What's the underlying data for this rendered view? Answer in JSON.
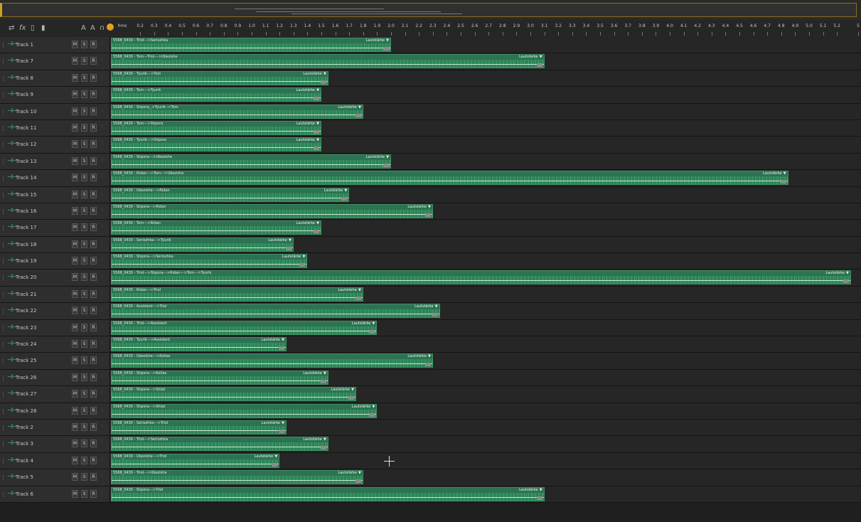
{
  "toolbar": {
    "swap_icon": "⇄",
    "fx_icon": "fx",
    "routing_icon": "▯",
    "meter_icon": "▮",
    "mute_icon": "A",
    "solo_icon": "A",
    "monitor_icon": "∩",
    "ruler_unit": "hms"
  },
  "ruler_labels": [
    "0.2",
    "0.3",
    "0.4",
    "0.5",
    "0.6",
    "0.7",
    "0.8",
    "0.9",
    "1.0",
    "1.1",
    "1.2",
    "1.3",
    "1.4",
    "1.5",
    "1.6",
    "1.7",
    "1.8",
    "1.9",
    "2.0",
    "2.1",
    "2.2",
    "2.3",
    "2.4",
    "2.5",
    "2.6",
    "2.7",
    "2.8",
    "2.9",
    "3.0",
    "3.1",
    "3.2",
    "3.3",
    "3.4",
    "3.5",
    "3.6",
    "3.7",
    "3.8",
    "3.9",
    "4.0",
    "4.1",
    "4.2",
    "4.3",
    "4.4",
    "4.5",
    "4.6",
    "4.7",
    "4.8",
    "4.9",
    "5.0",
    "5.1",
    "5.2",
    "5"
  ],
  "buttons": {
    "m": "M",
    "s": "S",
    "r": "R",
    "dots": "⋮"
  },
  "volume_label": "Lautstärke",
  "volume_arrow": "▼",
  "tracks": [
    {
      "name": "Track 1",
      "clip": "5568_0430 - Triol--->Seriozhka",
      "end_seconds": 2.0
    },
    {
      "name": "Track 7",
      "clip": "5568_0430 - Tom---Triol--->Ubezishe",
      "end_seconds": 3.1
    },
    {
      "name": "Track 8",
      "clip": "5568_0430 - Tyurik--->Tom",
      "end_seconds": 1.55
    },
    {
      "name": "Track 9",
      "clip": "5568_0430 - Tom--->Tyurik",
      "end_seconds": 1.5
    },
    {
      "name": "Track 10",
      "clip": "5568_0430 - Shpora_,>Tyurik-->Tom",
      "end_seconds": 1.8
    },
    {
      "name": "Track 11",
      "clip": "5568_0430 - Tom--->Shpora",
      "end_seconds": 1.5
    },
    {
      "name": "Track 12",
      "clip": "5568_0430 - Tyurik--->Shpora",
      "end_seconds": 1.5
    },
    {
      "name": "Track 13",
      "clip": "5568_0430 - Shpora--->Ubezishe",
      "end_seconds": 2.0
    },
    {
      "name": "Track 14",
      "clip": "5568_0430 - Ridan--->Tom--->Ubezishe",
      "end_seconds": 4.85
    },
    {
      "name": "Track 15",
      "clip": "5568_0430 - Ubezishe--->Ridan",
      "end_seconds": 1.7
    },
    {
      "name": "Track 16",
      "clip": "5568_0430 - Shpora--->Ridan",
      "end_seconds": 2.3
    },
    {
      "name": "Track 17",
      "clip": "5568_0430 - Tom--->Ridan",
      "end_seconds": 1.5
    },
    {
      "name": "Track 18",
      "clip": "5568_0430 - Seriozhka--->Tyurik",
      "end_seconds": 1.3
    },
    {
      "name": "Track 19",
      "clip": "5568_0430 - Shpora--->Seriozhka",
      "end_seconds": 1.4
    },
    {
      "name": "Track 20",
      "clip": "5568_0430 - Triol--->Shpora--->Ridan--->Tom--->Tyurik",
      "end_seconds": 5.3
    },
    {
      "name": "Track 21",
      "clip": "5568_0430 - Ridan--->Triol",
      "end_seconds": 1.8
    },
    {
      "name": "Track 22",
      "clip": "5568_0430 - Assistent--->Triol",
      "end_seconds": 2.35
    },
    {
      "name": "Track 23",
      "clip": "5568_0430 - Triol--->Assistent",
      "end_seconds": 1.9
    },
    {
      "name": "Track 24",
      "clip": "5568_0430 - Tyurik--->Assistent",
      "end_seconds": 1.25
    },
    {
      "name": "Track 25",
      "clip": "5568_0430 - Ubezishe--->Kotlas",
      "end_seconds": 2.3
    },
    {
      "name": "Track 26",
      "clip": "5568_0430 - Shpora--->Kotlas",
      "end_seconds": 1.55
    },
    {
      "name": "Track 27",
      "clip": "5568_0430 - Shpora--->Shtat",
      "end_seconds": 1.75
    },
    {
      "name": "Track 28",
      "clip": "5568_0430 - Shpora--->Shtat",
      "end_seconds": 1.9
    },
    {
      "name": "Track 2",
      "clip": "5568_0430 - Seriozhka--->Triol",
      "end_seconds": 1.25
    },
    {
      "name": "Track 3",
      "clip": "5568_0430 - Triol--->Seriozhka",
      "end_seconds": 1.55
    },
    {
      "name": "Track 4",
      "clip": "5568_0430 - Ubezishe--->Triol",
      "end_seconds": 1.2
    },
    {
      "name": "Track 5",
      "clip": "5568_0430 - Triol--->Ubezishe",
      "end_seconds": 1.8
    },
    {
      "name": "Track 6",
      "clip": "5568_0430 - Shpora--->Triol",
      "end_seconds": 3.1
    }
  ]
}
